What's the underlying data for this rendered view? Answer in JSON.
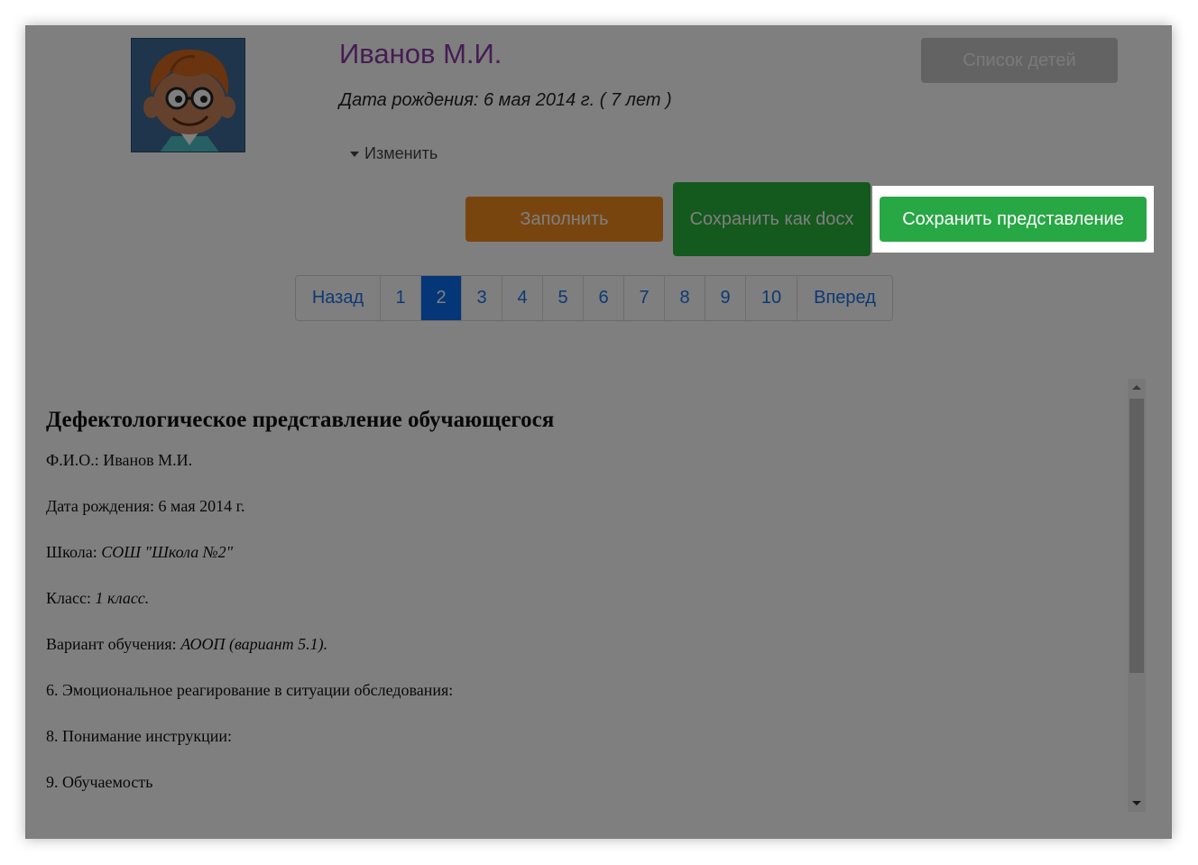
{
  "profile": {
    "name": "Иванов М.И.",
    "birth_line": "Дата рождения: 6 мая 2014 г. ( 7 лет )",
    "edit_label": "Изменить"
  },
  "buttons": {
    "children_list": "Список детей",
    "fill": "Заполнить",
    "save_docx": "Сохранить как docx",
    "save_view": "Сохранить представление"
  },
  "pagination": {
    "prev": "Назад",
    "pages": [
      "1",
      "2",
      "3",
      "4",
      "5",
      "6",
      "7",
      "8",
      "9",
      "10"
    ],
    "active": "2",
    "next": "Вперед"
  },
  "document": {
    "title": "Дефектологическое представление обучающегося",
    "fio_label": "Ф.И.О.: Иванов М.И.",
    "birth_label": "Дата рождения: 6 мая 2014 г.",
    "school_label": "Школа: ",
    "school_value": "СОШ \"Школа №2\"",
    "class_label": "Класс: ",
    "class_value": "1 класс.",
    "variant_label": "Вариант обучения: ",
    "variant_value": "АООП (вариант 5.1).",
    "item6": "6. Эмоциональное реагирование в ситуации обследования:",
    "item8": "8. Понимание инструкции:",
    "item9": "9. Обучаемость"
  },
  "colors": {
    "accent_green": "#28a745",
    "docx_green": "#28b23c",
    "fill_orange": "#f28a1f",
    "pagination_active": "#0a6cf0",
    "name_purple": "#8a3aa6"
  }
}
